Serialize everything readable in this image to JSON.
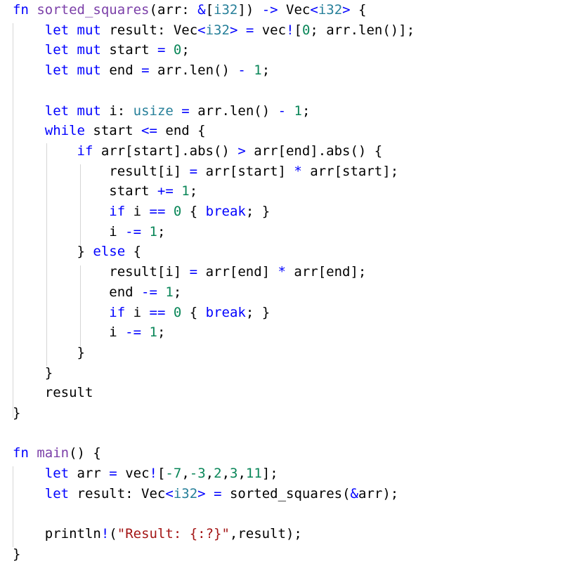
{
  "editor": {
    "language": "rust",
    "lines": [
      [
        {
          "t": "fn",
          "c": "kw"
        },
        {
          "t": " "
        },
        {
          "t": "sorted_squares",
          "c": "fnname"
        },
        {
          "t": "(arr: "
        },
        {
          "t": "&",
          "c": "op"
        },
        {
          "t": "["
        },
        {
          "t": "i32",
          "c": "ty"
        },
        {
          "t": "]) "
        },
        {
          "t": "->",
          "c": "op"
        },
        {
          "t": " Vec"
        },
        {
          "t": "<",
          "c": "op"
        },
        {
          "t": "i32",
          "c": "ty"
        },
        {
          "t": ">",
          "c": "op"
        },
        {
          "t": " {"
        }
      ],
      [
        {
          "t": "    "
        },
        {
          "t": "let",
          "c": "kw"
        },
        {
          "t": " "
        },
        {
          "t": "mut",
          "c": "kw"
        },
        {
          "t": " result: Vec"
        },
        {
          "t": "<",
          "c": "op"
        },
        {
          "t": "i32",
          "c": "ty"
        },
        {
          "t": ">",
          "c": "op"
        },
        {
          "t": " "
        },
        {
          "t": "=",
          "c": "op"
        },
        {
          "t": " vec"
        },
        {
          "t": "!",
          "c": "mac"
        },
        {
          "t": "["
        },
        {
          "t": "0",
          "c": "num"
        },
        {
          "t": "; arr.len()];"
        }
      ],
      [
        {
          "t": "    "
        },
        {
          "t": "let",
          "c": "kw"
        },
        {
          "t": " "
        },
        {
          "t": "mut",
          "c": "kw"
        },
        {
          "t": " start "
        },
        {
          "t": "=",
          "c": "op"
        },
        {
          "t": " "
        },
        {
          "t": "0",
          "c": "num"
        },
        {
          "t": ";"
        }
      ],
      [
        {
          "t": "    "
        },
        {
          "t": "let",
          "c": "kw"
        },
        {
          "t": " "
        },
        {
          "t": "mut",
          "c": "kw"
        },
        {
          "t": " end "
        },
        {
          "t": "=",
          "c": "op"
        },
        {
          "t": " arr.len() "
        },
        {
          "t": "-",
          "c": "op"
        },
        {
          "t": " "
        },
        {
          "t": "1",
          "c": "num"
        },
        {
          "t": ";"
        }
      ],
      [],
      [
        {
          "t": "    "
        },
        {
          "t": "let",
          "c": "kw"
        },
        {
          "t": " "
        },
        {
          "t": "mut",
          "c": "kw"
        },
        {
          "t": " i: "
        },
        {
          "t": "usize",
          "c": "ty"
        },
        {
          "t": " "
        },
        {
          "t": "=",
          "c": "op"
        },
        {
          "t": " arr.len() "
        },
        {
          "t": "-",
          "c": "op"
        },
        {
          "t": " "
        },
        {
          "t": "1",
          "c": "num"
        },
        {
          "t": ";"
        }
      ],
      [
        {
          "t": "    "
        },
        {
          "t": "while",
          "c": "kw"
        },
        {
          "t": " start "
        },
        {
          "t": "<=",
          "c": "op"
        },
        {
          "t": " end {"
        }
      ],
      [
        {
          "t": "        "
        },
        {
          "t": "if",
          "c": "kw"
        },
        {
          "t": " arr[start].abs() "
        },
        {
          "t": ">",
          "c": "op"
        },
        {
          "t": " arr[end].abs() {"
        }
      ],
      [
        {
          "t": "            result[i] "
        },
        {
          "t": "=",
          "c": "op"
        },
        {
          "t": " arr[start] "
        },
        {
          "t": "*",
          "c": "op"
        },
        {
          "t": " arr[start];"
        }
      ],
      [
        {
          "t": "            start "
        },
        {
          "t": "+=",
          "c": "op"
        },
        {
          "t": " "
        },
        {
          "t": "1",
          "c": "num"
        },
        {
          "t": ";"
        }
      ],
      [
        {
          "t": "            "
        },
        {
          "t": "if",
          "c": "kw"
        },
        {
          "t": " i "
        },
        {
          "t": "==",
          "c": "op"
        },
        {
          "t": " "
        },
        {
          "t": "0",
          "c": "num"
        },
        {
          "t": " { "
        },
        {
          "t": "break",
          "c": "kw"
        },
        {
          "t": "; }"
        }
      ],
      [
        {
          "t": "            i "
        },
        {
          "t": "-=",
          "c": "op"
        },
        {
          "t": " "
        },
        {
          "t": "1",
          "c": "num"
        },
        {
          "t": ";"
        }
      ],
      [
        {
          "t": "        } "
        },
        {
          "t": "else",
          "c": "kw"
        },
        {
          "t": " {"
        }
      ],
      [
        {
          "t": "            result[i] "
        },
        {
          "t": "=",
          "c": "op"
        },
        {
          "t": " arr[end] "
        },
        {
          "t": "*",
          "c": "op"
        },
        {
          "t": " arr[end];"
        }
      ],
      [
        {
          "t": "            end "
        },
        {
          "t": "-=",
          "c": "op"
        },
        {
          "t": " "
        },
        {
          "t": "1",
          "c": "num"
        },
        {
          "t": ";"
        }
      ],
      [
        {
          "t": "            "
        },
        {
          "t": "if",
          "c": "kw"
        },
        {
          "t": " i "
        },
        {
          "t": "==",
          "c": "op"
        },
        {
          "t": " "
        },
        {
          "t": "0",
          "c": "num"
        },
        {
          "t": " { "
        },
        {
          "t": "break",
          "c": "kw"
        },
        {
          "t": "; }"
        }
      ],
      [
        {
          "t": "            i "
        },
        {
          "t": "-=",
          "c": "op"
        },
        {
          "t": " "
        },
        {
          "t": "1",
          "c": "num"
        },
        {
          "t": ";"
        }
      ],
      [
        {
          "t": "        }"
        }
      ],
      [
        {
          "t": "    }"
        }
      ],
      [
        {
          "t": "    result"
        }
      ],
      [
        {
          "t": "}"
        }
      ],
      [],
      [
        {
          "t": "fn",
          "c": "kw"
        },
        {
          "t": " "
        },
        {
          "t": "main",
          "c": "fnname"
        },
        {
          "t": "() {"
        }
      ],
      [
        {
          "t": "    "
        },
        {
          "t": "let",
          "c": "kw"
        },
        {
          "t": " arr "
        },
        {
          "t": "=",
          "c": "op"
        },
        {
          "t": " vec"
        },
        {
          "t": "!",
          "c": "mac"
        },
        {
          "t": "["
        },
        {
          "t": "-7",
          "c": "num"
        },
        {
          "t": ","
        },
        {
          "t": "-3",
          "c": "num"
        },
        {
          "t": ","
        },
        {
          "t": "2",
          "c": "num"
        },
        {
          "t": ","
        },
        {
          "t": "3",
          "c": "num"
        },
        {
          "t": ","
        },
        {
          "t": "11",
          "c": "num"
        },
        {
          "t": "];"
        }
      ],
      [
        {
          "t": "    "
        },
        {
          "t": "let",
          "c": "kw"
        },
        {
          "t": " result: Vec"
        },
        {
          "t": "<",
          "c": "op"
        },
        {
          "t": "i32",
          "c": "ty"
        },
        {
          "t": ">",
          "c": "op"
        },
        {
          "t": " "
        },
        {
          "t": "=",
          "c": "op"
        },
        {
          "t": " sorted_squares("
        },
        {
          "t": "&",
          "c": "op"
        },
        {
          "t": "arr);"
        }
      ],
      [],
      [
        {
          "t": "    println"
        },
        {
          "t": "!",
          "c": "mac"
        },
        {
          "t": "("
        },
        {
          "t": "\"Result: {:?}\"",
          "c": "str"
        },
        {
          "t": ",result);"
        }
      ],
      [
        {
          "t": "}"
        }
      ]
    ]
  }
}
